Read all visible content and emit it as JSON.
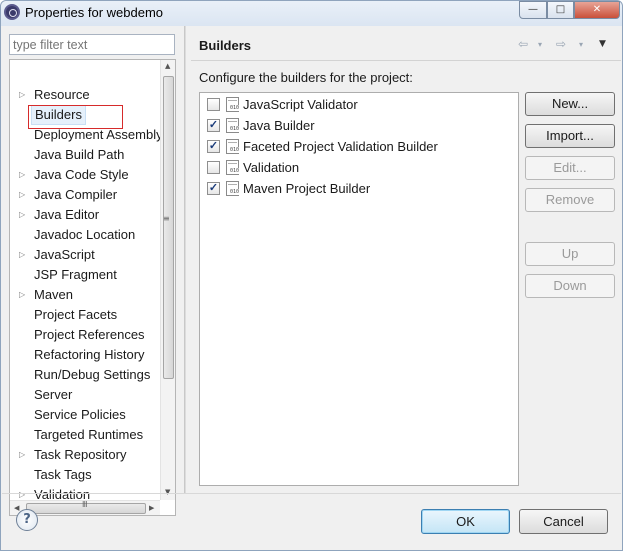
{
  "window": {
    "title": "Properties for webdemo",
    "controls": {
      "minimize": "—",
      "maximize": "□",
      "close": "✕"
    }
  },
  "filter": {
    "placeholder": "type filter text"
  },
  "tree": {
    "items": [
      {
        "label": "Resource",
        "expandable": true
      },
      {
        "label": "Builders",
        "expandable": false,
        "selected": true
      },
      {
        "label": "Deployment Assembly",
        "expandable": false
      },
      {
        "label": "Java Build Path",
        "expandable": false
      },
      {
        "label": "Java Code Style",
        "expandable": true
      },
      {
        "label": "Java Compiler",
        "expandable": true
      },
      {
        "label": "Java Editor",
        "expandable": true
      },
      {
        "label": "Javadoc Location",
        "expandable": false
      },
      {
        "label": "JavaScript",
        "expandable": true
      },
      {
        "label": "JSP Fragment",
        "expandable": false
      },
      {
        "label": "Maven",
        "expandable": true
      },
      {
        "label": "Project Facets",
        "expandable": false
      },
      {
        "label": "Project References",
        "expandable": false
      },
      {
        "label": "Refactoring History",
        "expandable": false
      },
      {
        "label": "Run/Debug Settings",
        "expandable": false
      },
      {
        "label": "Server",
        "expandable": false
      },
      {
        "label": "Service Policies",
        "expandable": false
      },
      {
        "label": "Targeted Runtimes",
        "expandable": false
      },
      {
        "label": "Task Repository",
        "expandable": true
      },
      {
        "label": "Task Tags",
        "expandable": false
      },
      {
        "label": "Validation",
        "expandable": true
      }
    ]
  },
  "page": {
    "title": "Builders",
    "description": "Configure the builders for the project:",
    "nav": {
      "back": "⇦",
      "forward": "⇨",
      "menu": "▼",
      "dropdown": "▾"
    }
  },
  "builders": [
    {
      "name": "JavaScript Validator",
      "checked": false
    },
    {
      "name": "Java Builder",
      "checked": true
    },
    {
      "name": "Faceted Project Validation Builder",
      "checked": true
    },
    {
      "name": "Validation",
      "checked": false
    },
    {
      "name": "Maven Project Builder",
      "checked": true
    }
  ],
  "actions": {
    "new": "New...",
    "import": "Import...",
    "edit": "Edit...",
    "remove": "Remove",
    "up": "Up",
    "down": "Down"
  },
  "footer": {
    "help": "?",
    "ok": "OK",
    "cancel": "Cancel"
  }
}
